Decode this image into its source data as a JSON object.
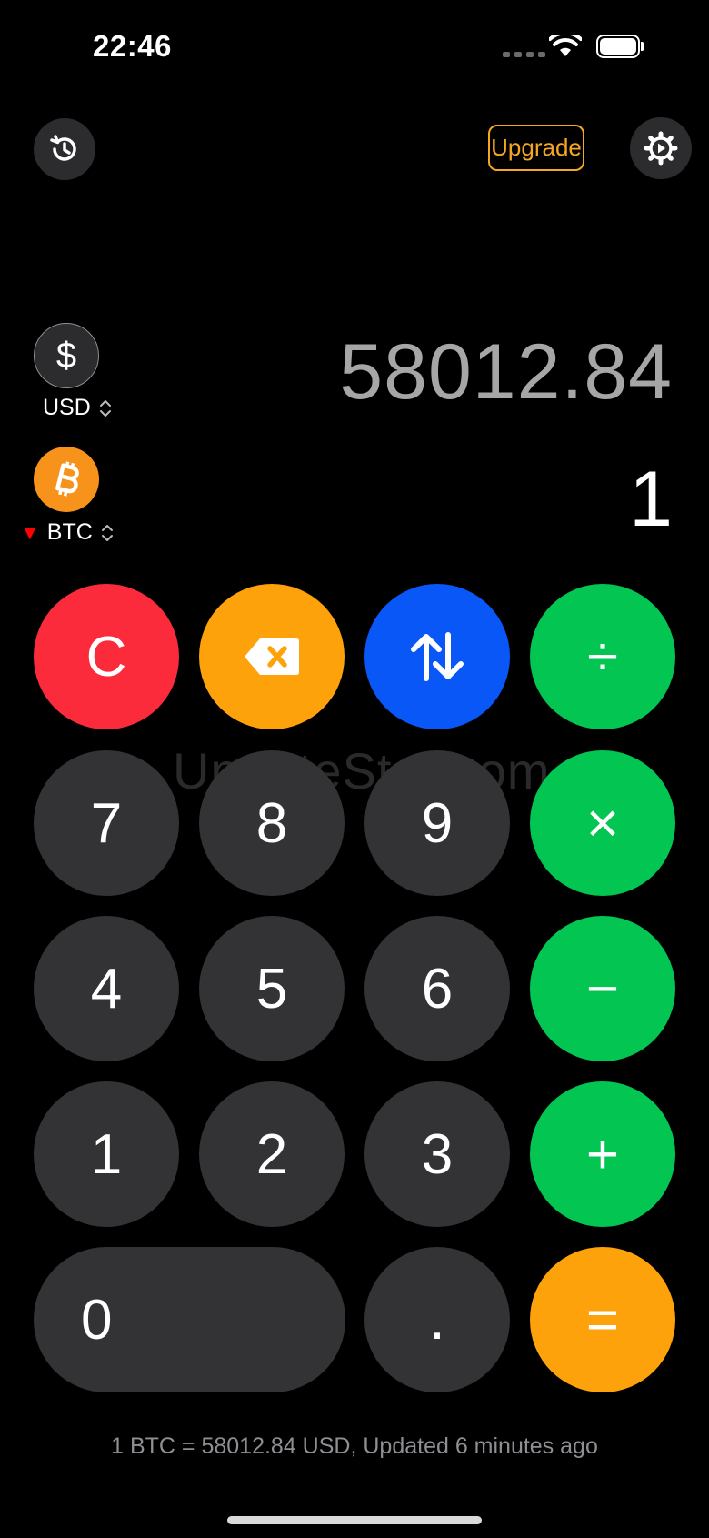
{
  "status_bar": {
    "time": "22:46"
  },
  "header": {
    "upgrade_label": "Upgrade"
  },
  "converter": {
    "top": {
      "symbol": "$",
      "code": "USD",
      "value": "58012.84"
    },
    "bottom": {
      "code": "BTC",
      "value": "1",
      "trend": "down"
    }
  },
  "keypad": {
    "rows": [
      [
        "C",
        "backspace",
        "swap",
        "÷"
      ],
      [
        "7",
        "8",
        "9",
        "×"
      ],
      [
        "4",
        "5",
        "6",
        "−"
      ],
      [
        "1",
        "2",
        "3",
        "+"
      ],
      [
        "0",
        ".",
        "="
      ]
    ],
    "labels": {
      "clear": "C",
      "divide": "÷",
      "multiply": "×",
      "minus": "−",
      "plus": "+",
      "seven": "7",
      "eight": "8",
      "nine": "9",
      "four": "4",
      "five": "5",
      "six": "6",
      "one": "1",
      "two": "2",
      "three": "3",
      "zero": "0",
      "dot": ".",
      "equals": "="
    }
  },
  "watermark": "UpdateStar.com",
  "footer": {
    "rate_text": "1 BTC = 58012.84 USD, Updated 6 minutes ago"
  },
  "colors": {
    "clear": "#fc2b3c",
    "backspace": "#fea20c",
    "swap": "#0a57f7",
    "operators": "#03c552",
    "equals": "#fea20c",
    "upgrade": "#f5a623",
    "bitcoin": "#f7931a"
  }
}
